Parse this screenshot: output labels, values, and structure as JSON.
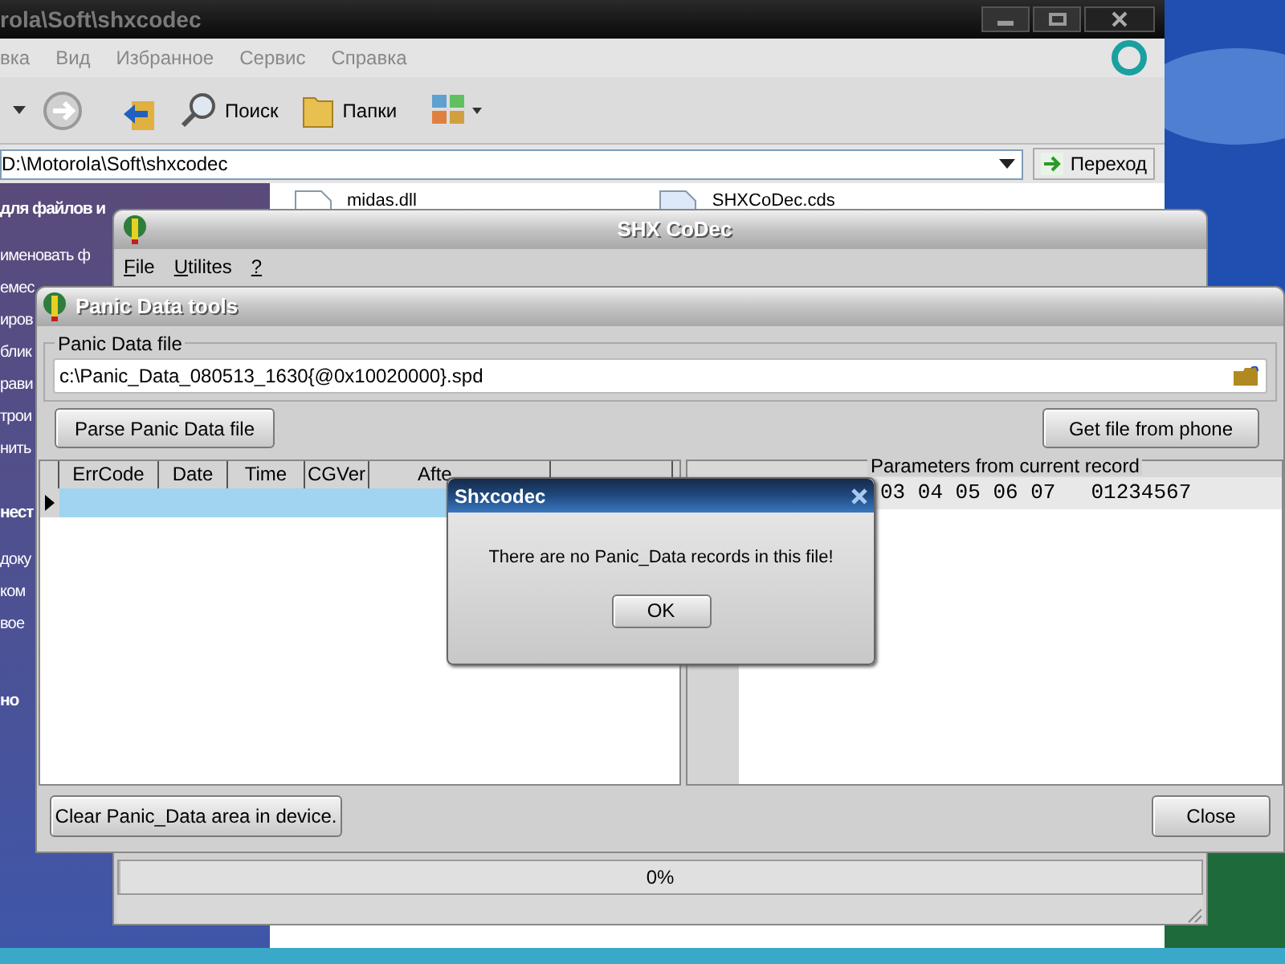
{
  "explorer": {
    "title": "rola\\Soft\\shxcodec",
    "menu": [
      "вка",
      "Вид",
      "Избранное",
      "Сервис",
      "Справка"
    ],
    "toolbar": [
      {
        "kind": "search",
        "label": "Поиск"
      },
      {
        "kind": "folders",
        "label": "Папки"
      }
    ],
    "address": "D:\\Motorola\\Soft\\shxcodec",
    "go_button": "Переход",
    "task_pane": [
      {
        "title": "для файлов и",
        "links": [
          "именовать ф",
          "емес",
          "иров",
          "блик",
          "рави",
          "трои",
          "нить"
        ]
      },
      {
        "title": "нест",
        "links": [
          "доку",
          "ком",
          "вое"
        ]
      },
      {
        "title": "но"
      }
    ],
    "files": [
      {
        "kind": "dll",
        "name": "midas.dll"
      },
      {
        "kind": "cds",
        "name": "SHXCoDec.cds"
      }
    ]
  },
  "shx_window": {
    "title": "SHX CoDec",
    "menu": [
      "File",
      "Utilites",
      "?"
    ],
    "progress": {
      "level": 0,
      "label": "0%"
    }
  },
  "panic_window": {
    "title": "Panic Data tools",
    "file_group": "Panic Data file",
    "file_path": "c:\\Panic_Data_080513_1630{@0x10020000}.spd",
    "parse_button": "Parse Panic Data file",
    "get_button": "Get file from phone",
    "grid": {
      "columns": [
        "ErrCode",
        "Date",
        "Time",
        "CGVer",
        "Afte",
        ""
      ],
      "rows": [
        {
          "selected": true
        }
      ]
    },
    "params_group": "Parameters from current record",
    "hex": "03 04 05 06 07",
    "ascii": "01234567",
    "clear_button": "Clear Panic_Data area in device.",
    "close_button": "Close"
  },
  "dialog": {
    "title": "Shxcodec",
    "message": "There are no Panic_Data records in this file!",
    "ok_button": "OK"
  }
}
